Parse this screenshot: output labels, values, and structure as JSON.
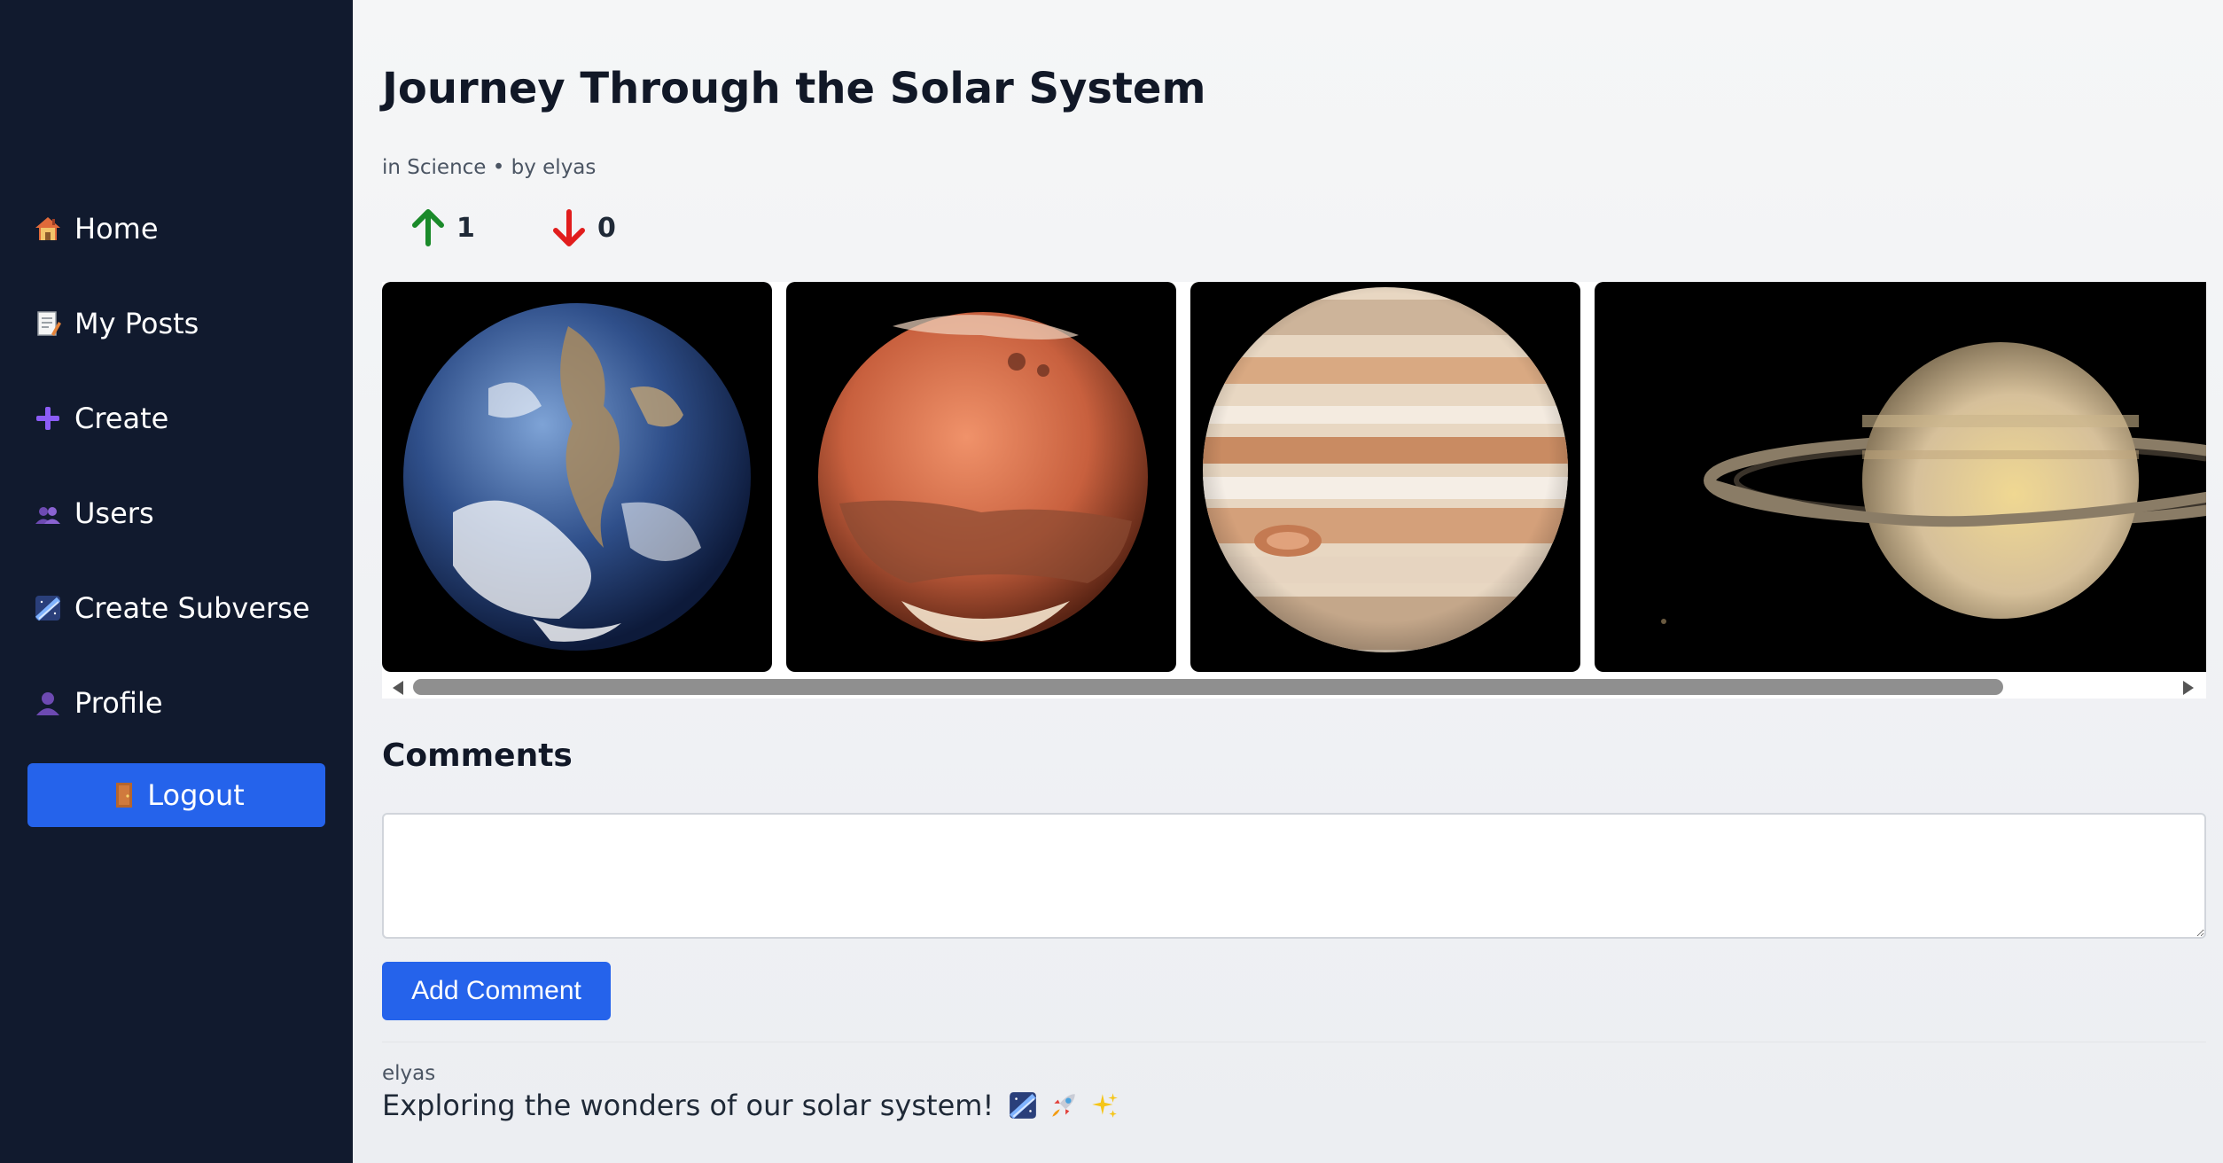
{
  "sidebar": {
    "items": [
      {
        "label": "Home",
        "icon": "house-icon"
      },
      {
        "label": "My Posts",
        "icon": "memo-icon"
      },
      {
        "label": "Create",
        "icon": "plus-icon"
      },
      {
        "label": "Users",
        "icon": "users-icon"
      },
      {
        "label": "Create Subverse",
        "icon": "milky-way-icon"
      },
      {
        "label": "Profile",
        "icon": "user-icon"
      }
    ],
    "logout_label": "Logout",
    "logout_icon": "door-icon"
  },
  "post": {
    "title": "Journey Through the Solar System",
    "meta": "in Science • by elyas",
    "upvotes": "1",
    "downvotes": "0",
    "images": [
      "Earth",
      "Mars",
      "Jupiter",
      "Saturn"
    ]
  },
  "comments": {
    "heading": "Comments",
    "input_value": "",
    "add_button_label": "Add Comment",
    "items": [
      {
        "author": "elyas",
        "text": "Exploring the wonders of our solar system!",
        "emojis": [
          "milky-way-icon",
          "rocket-icon",
          "sparkles-icon"
        ]
      }
    ]
  },
  "colors": {
    "sidebar_bg": "#111a2e",
    "accent": "#2563eb",
    "upvote": "#16a34a",
    "downvote": "#dc2626"
  }
}
